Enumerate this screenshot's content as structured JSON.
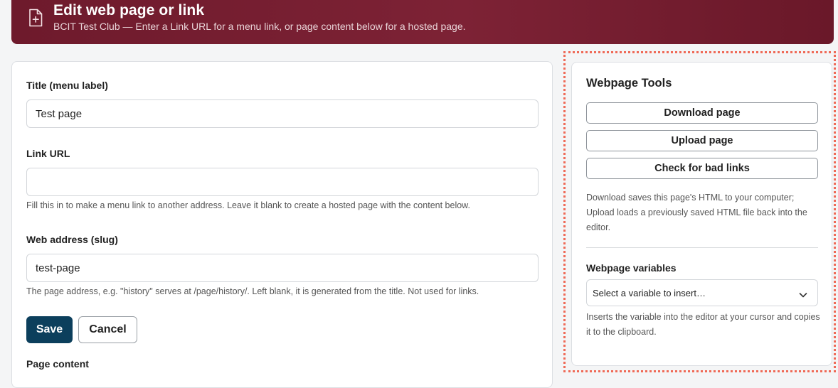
{
  "banner": {
    "title": "Edit web page or link",
    "subtitle": "BCIT Test Club — Enter a Link URL for a menu link, or page content below for a hosted page.",
    "icon": "file-plus-icon"
  },
  "form": {
    "title_label": "Title (menu label)",
    "title_value": "Test page",
    "link_label": "Link URL",
    "link_value": "",
    "link_help": "Fill this in to make a menu link to another address. Leave it blank to create a hosted page with the content below.",
    "slug_label": "Web address (slug)",
    "slug_value": "test-page",
    "slug_help": "The page address, e.g. \"history\" serves at /page/history/. Left blank, it is generated from the title. Not used for links.",
    "save_label": "Save",
    "cancel_label": "Cancel",
    "content_label": "Page content"
  },
  "tools": {
    "title": "Webpage Tools",
    "download_label": "Download page",
    "upload_label": "Upload page",
    "check_label": "Check for bad links",
    "help": "Download saves this page's HTML to your computer; Upload loads a previously saved HTML file back into the editor.",
    "vars_label": "Webpage variables",
    "select_value": "Select a variable to insert…",
    "vars_help": "Inserts the variable into the editor at your cursor and copies it to the clipboard."
  },
  "colors": {
    "banner": "#7d2235",
    "primary_button": "#0c3f5c",
    "highlight_border": "#ef6a57"
  }
}
